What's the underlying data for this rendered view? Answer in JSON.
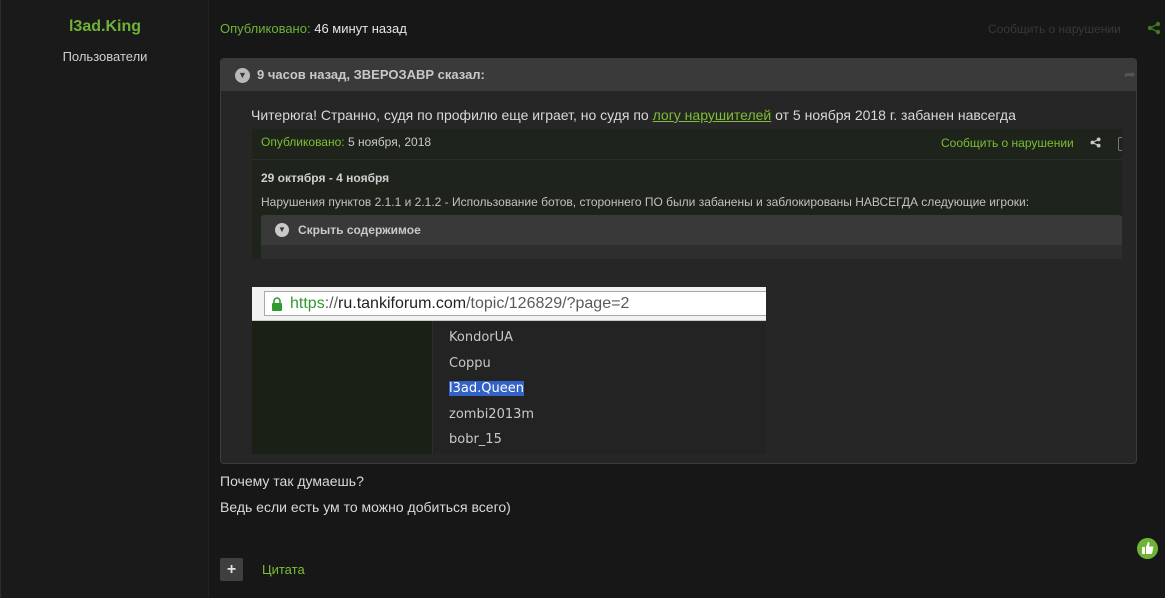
{
  "author": {
    "name": "l3ad.King",
    "group": "Пользователи"
  },
  "post": {
    "published_label": "Опубликовано:",
    "published_time": "46 минут назад",
    "report_label": "Сообщить о нарушении"
  },
  "quote": {
    "cite": "9 часов назад, ЗВЕРОЗАВР сказал:",
    "text_before": "Читерюга! Странно, судя по профилю еще играет, но судя по ",
    "link_text": "логу нарушителей",
    "text_after": " от 5 ноября 2018 г. забанен навсегда"
  },
  "embedded_post": {
    "published_label": "Опубликовано:",
    "published_date": "5 ноября, 2018",
    "report_label": "Сообщить о нарушении",
    "dates": "29 октября - 4 ноября",
    "violation_text": "Нарушения  пунктов 2.1.1 и 2.1.2  -  Использование ботов, стороннего ПО  были забанены и заблокированы НАВСЕГДА следующие игроки:",
    "spoiler_label": "Скрыть содержимое"
  },
  "browser_shot": {
    "url_scheme": "https",
    "url_sep": "://",
    "url_host": "ru.tankiforum.com",
    "url_path": "/topic/126829/?page=2",
    "names": [
      "KondorUA",
      "Coppu",
      "l3ad.Queen",
      "zombi2013m",
      "bobr_15"
    ],
    "selected_name_index": 2
  },
  "reply": {
    "line1": "Почему так думаешь?",
    "line2": "Ведь если есть ум то можно добиться всего)"
  },
  "actions": {
    "plus_label": "+",
    "quote_label": "Цитата"
  },
  "colors": {
    "accent": "#6fb336",
    "link": "#7bbf34",
    "background": "#171717",
    "selection": "#3262c6"
  },
  "icons": {
    "share": "share-icon",
    "chevron": "chevron-down-icon",
    "lock": "lock-icon",
    "like": "thumbs-up-icon"
  }
}
